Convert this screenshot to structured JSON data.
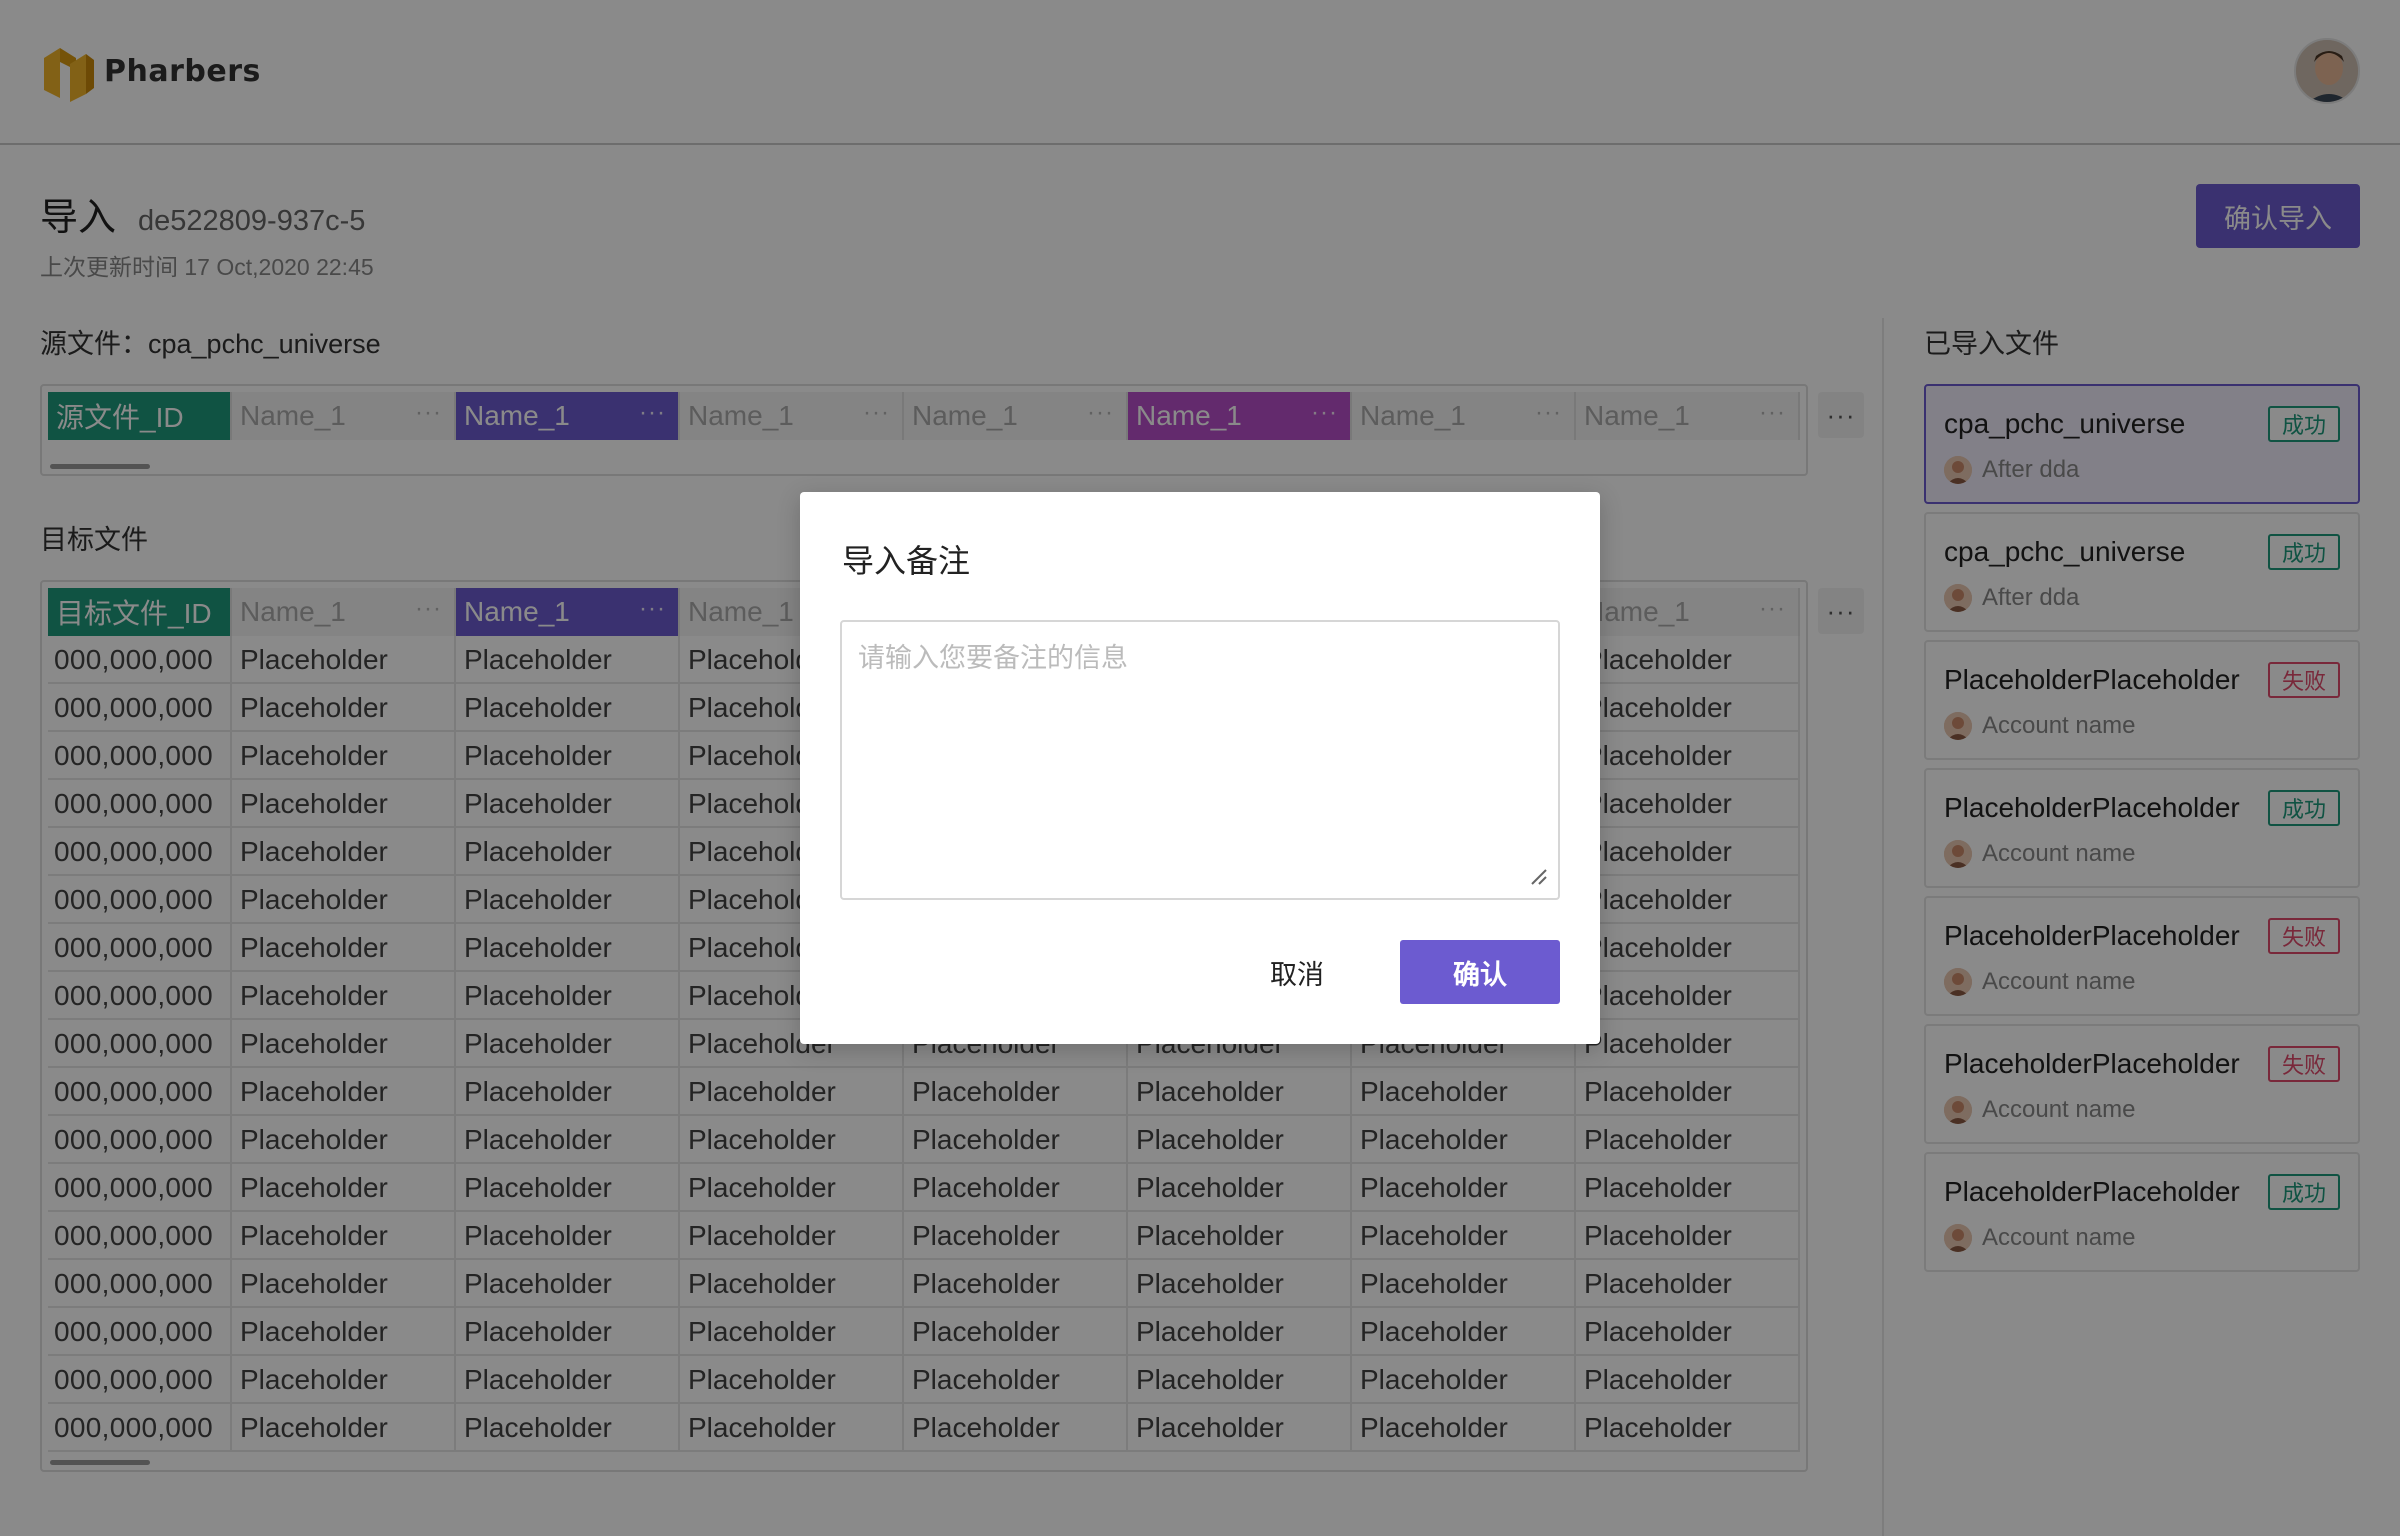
{
  "app": {
    "brand": "Pharbers"
  },
  "page": {
    "title": "导入",
    "id": "de522809-937c-5",
    "last_update": "上次更新时间 17 Oct,2020 22:45",
    "confirm_import_label": "确认导入"
  },
  "source": {
    "label": "源文件：cpa_pchc_universe",
    "columns": [
      "源文件_ID",
      "Name_1",
      "Name_1",
      "Name_1",
      "Name_1",
      "Name_1",
      "Name_1",
      "Name_1"
    ],
    "more_label": "···"
  },
  "target": {
    "label": "目标文件",
    "columns": [
      "目标文件_ID",
      "Name_1",
      "Name_1",
      "Name_1",
      "Name_1",
      "Name_1",
      "Name_1",
      "Name_1"
    ],
    "more_label": "···",
    "row_id": "000,000,000",
    "cell_value": "Placeholder",
    "row_count": 17
  },
  "imported": {
    "label": "已导入文件",
    "files": [
      {
        "name": "cpa_pchc_universe",
        "status": "成功",
        "state": "ok",
        "account": "After dda",
        "active": true
      },
      {
        "name": "cpa_pchc_universe",
        "status": "成功",
        "state": "ok",
        "account": "After dda",
        "active": false
      },
      {
        "name": "PlaceholderPlaceholder",
        "status": "失败",
        "state": "fail",
        "account": "Account name",
        "active": false
      },
      {
        "name": "PlaceholderPlaceholder",
        "status": "成功",
        "state": "ok",
        "account": "Account name",
        "active": false
      },
      {
        "name": "PlaceholderPlaceholder",
        "status": "失败",
        "state": "fail",
        "account": "Account name",
        "active": false
      },
      {
        "name": "PlaceholderPlaceholder",
        "status": "失败",
        "state": "fail",
        "account": "Account name",
        "active": false
      },
      {
        "name": "PlaceholderPlaceholder",
        "status": "成功",
        "state": "ok",
        "account": "Account name",
        "active": false
      }
    ]
  },
  "modal": {
    "title": "导入备注",
    "placeholder": "请输入您要备注的信息",
    "value": "",
    "cancel_label": "取消",
    "ok_label": "确认"
  },
  "colors": {
    "accent": "#6c5bd0",
    "teal": "#1f9a7d",
    "magenta": "#b84fc9",
    "success": "#1f9a7d",
    "fail": "#e04b6c"
  }
}
